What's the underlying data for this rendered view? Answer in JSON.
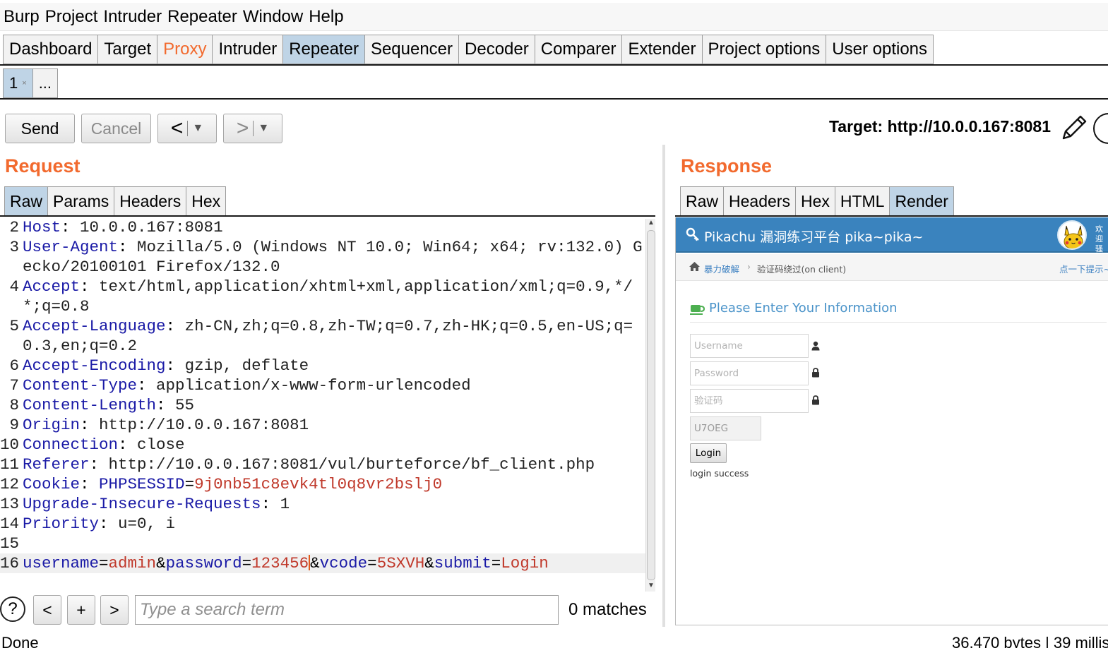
{
  "menu": [
    "Burp",
    "Project",
    "Intruder",
    "Repeater",
    "Window",
    "Help"
  ],
  "main_tabs": [
    "Dashboard",
    "Target",
    "Proxy",
    "Intruder",
    "Repeater",
    "Sequencer",
    "Decoder",
    "Comparer",
    "Extender",
    "Project options",
    "User options"
  ],
  "repeater_tabs": {
    "first": "1",
    "first_close": "×",
    "more": "..."
  },
  "toolbar": {
    "send": "Send",
    "cancel": "Cancel",
    "back": "<",
    "forward": ">",
    "dropdown": "▼"
  },
  "target_label": "Target: http://10.0.0.167:8081",
  "request": {
    "title": "Request",
    "tabs": [
      "Raw",
      "Params",
      "Headers",
      "Hex"
    ],
    "lines": [
      {
        "n": "2",
        "key": "Host",
        "value": " 10.0.0.167:8081"
      },
      {
        "n": "3",
        "key": "User-Agent",
        "value": " Mozilla/5.0 (Windows NT 10.0; Win64; x64; rv:132.0) Gecko/20100101 Firefox/132.0"
      },
      {
        "n": "4",
        "key": "Accept",
        "value": " text/html,application/xhtml+xml,application/xml;q=0.9,*/*;q=0.8"
      },
      {
        "n": "5",
        "key": "Accept-Language",
        "value": " zh-CN,zh;q=0.8,zh-TW;q=0.7,zh-HK;q=0.5,en-US;q=0.3,en;q=0.2"
      },
      {
        "n": "6",
        "key": "Accept-Encoding",
        "value": " gzip, deflate"
      },
      {
        "n": "7",
        "key": "Content-Type",
        "value": " application/x-www-form-urlencoded"
      },
      {
        "n": "8",
        "key": "Content-Length",
        "value": " 55"
      },
      {
        "n": "9",
        "key": "Origin",
        "value": " http://10.0.0.167:8081"
      },
      {
        "n": "10",
        "key": "Connection",
        "value": " close"
      },
      {
        "n": "11",
        "key": "Referer",
        "value": " http://10.0.0.167:8081/vul/burteforce/bf_client.php"
      },
      {
        "n": "13",
        "key": "Upgrade-Insecure-Requests",
        "value": " 1"
      },
      {
        "n": "14",
        "key": "Priority",
        "value": " u=0, i"
      }
    ],
    "cookie": {
      "n": "12",
      "key": "Cookie",
      "name": "PHPSESSID",
      "value": "9j0nb51c8evk4tl0q8vr2bslj0"
    },
    "blank_line": "15",
    "body": {
      "n": "16",
      "k1": "username",
      "v1": "admin",
      "k2": "password",
      "v2": "123456",
      "k3": "vcode",
      "v3": "5SXVH",
      "k4": "submit",
      "v4": "Login"
    }
  },
  "search": {
    "help": "?",
    "prev": "<",
    "add": "+",
    "next": ">",
    "placeholder": "Type a search term",
    "matches": "0 matches"
  },
  "response": {
    "title": "Response",
    "tabs": [
      "Raw",
      "Headers",
      "Hex",
      "HTML",
      "Render"
    ]
  },
  "rendered_page": {
    "title": "Pikachu 漏洞练习平台 pika~pika~",
    "welcome_line1": "欢迎",
    "welcome_line2": "骚年",
    "crumb_parent": "暴力破解",
    "crumb_sep": "›",
    "crumb_current": "验证码绕过(on client)",
    "tip": "点一下提示~",
    "section_title": "Please Enter Your Information",
    "username_placeholder": "Username",
    "password_placeholder": "Password",
    "vcode_placeholder": "验证码",
    "captcha": "U7OEG",
    "login_button": "Login",
    "message": "login success"
  },
  "status": {
    "left": "Done",
    "right": "36,470 bytes | 39 millis"
  }
}
